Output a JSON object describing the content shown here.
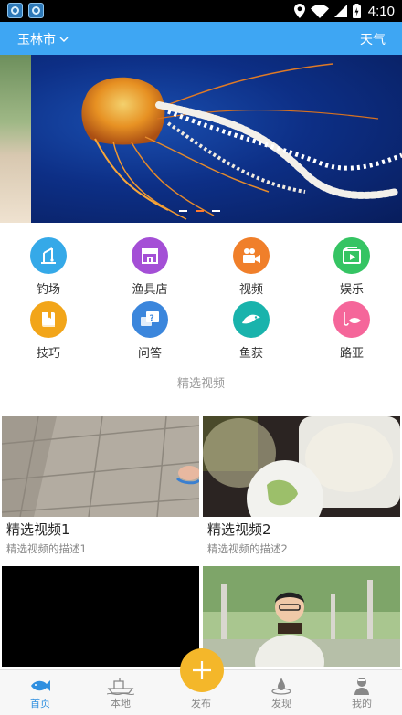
{
  "status_bar": {
    "time": "4:10",
    "icons": [
      "app-icon-1",
      "app-icon-2",
      "location-icon",
      "wifi-icon",
      "signal-icon",
      "battery-icon"
    ]
  },
  "header": {
    "city": "玉林市",
    "weather": "天气"
  },
  "banner": {
    "slide_count": 3,
    "active_slide": 2
  },
  "categories": [
    {
      "label": "钓场",
      "icon": "fishing-spot-icon",
      "color": "#35a9e8"
    },
    {
      "label": "渔具店",
      "icon": "tackle-shop-icon",
      "color": "#a44fd6"
    },
    {
      "label": "视频",
      "icon": "video-camera-icon",
      "color": "#f07f2a"
    },
    {
      "label": "娱乐",
      "icon": "entertainment-icon",
      "color": "#35c463"
    },
    {
      "label": "技巧",
      "icon": "tips-book-icon",
      "color": "#f2a519"
    },
    {
      "label": "问答",
      "icon": "qa-icon",
      "color": "#3b86dc"
    },
    {
      "label": "鱼获",
      "icon": "catch-fish-icon",
      "color": "#19b3ac"
    },
    {
      "label": "路亚",
      "icon": "lure-icon",
      "color": "#f5669a"
    }
  ],
  "section": {
    "title": "— 精选视频 —"
  },
  "videos": [
    {
      "title": "精选视频1",
      "desc": "精选视频的描述1"
    },
    {
      "title": "精选视频2",
      "desc": "精选视频的描述2"
    },
    {
      "title": "",
      "desc": ""
    },
    {
      "title": "",
      "desc": ""
    }
  ],
  "tabs": [
    {
      "label": "首页",
      "icon": "fish-icon",
      "active": true
    },
    {
      "label": "本地",
      "icon": "boat-icon",
      "active": false
    },
    {
      "label": "发布",
      "icon": "plus-icon",
      "active": false
    },
    {
      "label": "发现",
      "icon": "discover-icon",
      "active": false
    },
    {
      "label": "我的",
      "icon": "profile-icon",
      "active": false
    }
  ],
  "colors": {
    "header_bg": "#3ea6f3",
    "active_tab": "#2f8fe0",
    "publish_button": "#f4b72a"
  }
}
